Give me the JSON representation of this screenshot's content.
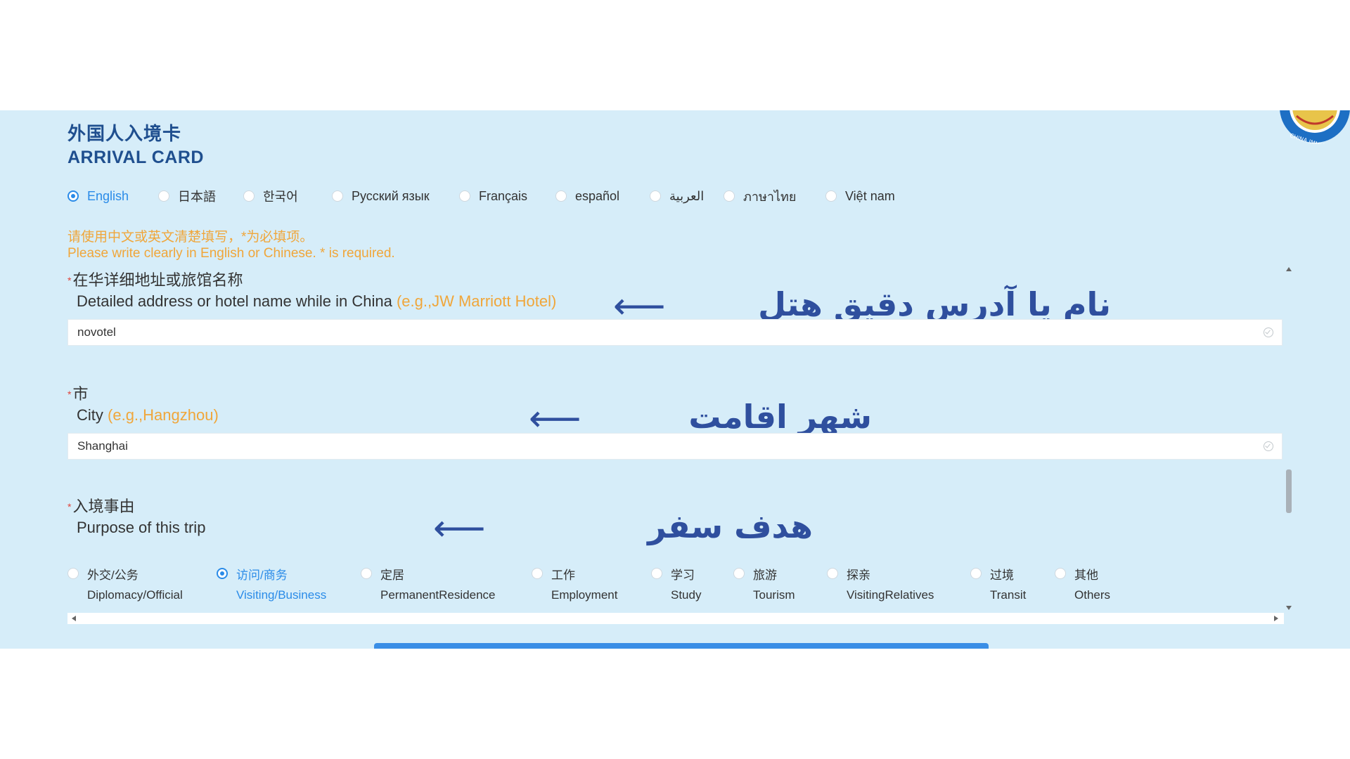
{
  "header": {
    "title_cn": "外国人入境卡",
    "title_en": "ARRIVAL CARD",
    "emblem_text": "CHINA IMMIGRATION"
  },
  "languages": [
    {
      "label": "English",
      "selected": true
    },
    {
      "label": "日本語",
      "selected": false
    },
    {
      "label": "한국어",
      "selected": false
    },
    {
      "label": "Русский язык",
      "selected": false
    },
    {
      "label": "Français",
      "selected": false
    },
    {
      "label": "español",
      "selected": false
    },
    {
      "label": "العربية",
      "selected": false
    },
    {
      "label": "ภาษาไทย",
      "selected": false
    },
    {
      "label": "Việt nam",
      "selected": false
    }
  ],
  "notice": {
    "cn": "请使用中文或英文清楚填写，*为必填项。",
    "en": "Please write clearly in English or Chinese. * is required."
  },
  "address": {
    "required_mark": "*",
    "label_cn": "在华详细地址或旅馆名称",
    "label_en": "Detailed address or hotel name while in China",
    "hint": "(e.g.,JW Marriott Hotel)",
    "value": "novotel",
    "overlay": "نام یا آدرس دقیق هتل"
  },
  "city": {
    "required_mark": "*",
    "label_cn": "市",
    "label_en": "City",
    "hint": "(e.g.,Hangzhou)",
    "value": "Shanghai",
    "overlay": "شهر اقامت"
  },
  "purpose": {
    "required_mark": "*",
    "label_cn": "入境事由",
    "label_en": "Purpose of this trip",
    "overlay": "هدف سفر",
    "options": [
      {
        "cn": "外交/公务",
        "en": "Diplomacy/Official",
        "selected": false
      },
      {
        "cn": "访问/商务",
        "en": "Visiting/Business",
        "selected": true
      },
      {
        "cn": "定居",
        "en": "PermanentResidence",
        "selected": false
      },
      {
        "cn": "工作",
        "en": "Employment",
        "selected": false
      },
      {
        "cn": "学习",
        "en": "Study",
        "selected": false
      },
      {
        "cn": "旅游",
        "en": "Tourism",
        "selected": false
      },
      {
        "cn": "探亲",
        "en": "VisitingRelatives",
        "selected": false
      },
      {
        "cn": "过境",
        "en": "Transit",
        "selected": false
      },
      {
        "cn": "其他",
        "en": "Others",
        "selected": false
      }
    ]
  },
  "arrow_glyph": "⟵",
  "colors": {
    "accent": "#2a8be8",
    "hint": "#f0a63a",
    "overlay": "#2f4f9e",
    "band": "#d6edf9"
  }
}
